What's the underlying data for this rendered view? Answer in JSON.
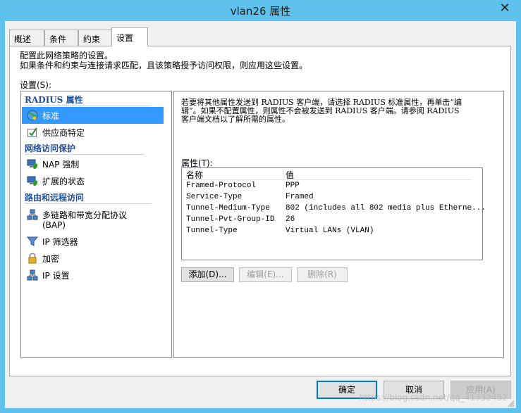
{
  "window": {
    "title": "vlan26 属性",
    "close_glyph": "✕"
  },
  "tabs": [
    {
      "label": "概述"
    },
    {
      "label": "条件"
    },
    {
      "label": "约束"
    },
    {
      "label": "设置"
    }
  ],
  "description": {
    "line1": "配置此网络策略的设置。",
    "line2": "如果条件和约束与连接请求匹配，且该策略授予访问权限，则应用这些设置。"
  },
  "settings_label": "设置(S):",
  "nav": {
    "groups": [
      {
        "title": "RADIUS 属性"
      },
      {
        "title": "网络访问保护"
      },
      {
        "title": "路由和远程访问"
      }
    ],
    "items": [
      {
        "label": "标准",
        "icon": "globe-icon"
      },
      {
        "label": "供应商特定",
        "icon": "checkbox-icon"
      },
      {
        "label": "NAP 强制",
        "icon": "computer-shield-icon"
      },
      {
        "label": "扩展的状态",
        "icon": "computer-shield-icon"
      },
      {
        "label": "多链路和带宽分配协议",
        "sub": "(BAP)",
        "icon": "network-icon"
      },
      {
        "label": "IP 筛选器",
        "icon": "filter-icon"
      },
      {
        "label": "加密",
        "icon": "lock-icon"
      },
      {
        "label": "IP 设置",
        "icon": "network-icon"
      }
    ]
  },
  "right": {
    "description_line1": "若要将其他属性发送到 RADIUS 客户端，请选择 RADIUS 标准属性，再单击“编",
    "description_line2": "辑”。如果不配置属性，则属性不会被发送到 RADIUS 客户端。请参阅 RADIUS",
    "description_line3": "客户端文档以了解所需的属性。",
    "attributes_label": "属性(T):",
    "columns": {
      "name": "名称",
      "value": "值"
    },
    "rows": [
      {
        "name": "Framed-Protocol",
        "value": "PPP"
      },
      {
        "name": "Service-Type",
        "value": "Framed"
      },
      {
        "name": "Tunnel-Medium-Type",
        "value": "802 (includes all 802 media plus Etherne..."
      },
      {
        "name": "Tunnel-Pvt-Group-ID",
        "value": "26"
      },
      {
        "name": "Tunnel-Type",
        "value": "Virtual LANs (VLAN)"
      }
    ],
    "buttons": {
      "add": "添加(D)...",
      "edit": "编辑(E)...",
      "remove": "删除(R)"
    }
  },
  "footer": {
    "ok": "确定",
    "cancel": "取消",
    "apply": "应用(A)"
  },
  "watermark": "https://blog.csdn.net/qq_41332452",
  "colors": {
    "titlebar": "#5fc2ec",
    "selection": "#3399ff",
    "group_title": "#1f4e9c"
  }
}
